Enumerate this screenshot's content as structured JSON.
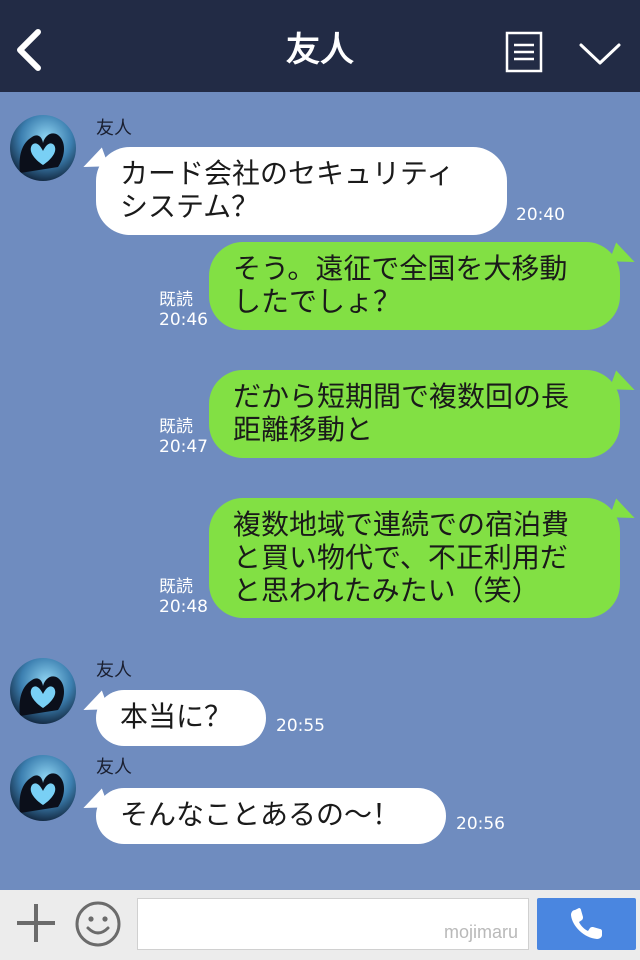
{
  "header": {
    "title": "友人"
  },
  "messages": [
    {
      "direction": "in",
      "sender": "友人",
      "lines": [
        "カード会社のセキュリティ",
        "システム？"
      ],
      "time": "20:40"
    },
    {
      "direction": "out",
      "read": "既読",
      "lines": [
        "そう。遠征で全国を大移動",
        "したでしょ？"
      ],
      "time": "20:46"
    },
    {
      "direction": "out",
      "read": "既読",
      "lines": [
        "だから短期間で複数回の長",
        "距離移動と"
      ],
      "time": "20:47"
    },
    {
      "direction": "out",
      "read": "既読",
      "lines": [
        "複数地域で連続での宿泊費",
        "と買い物代で、不正利用だ",
        "と思われたみたい（笑）"
      ],
      "time": "20:48"
    },
    {
      "direction": "in",
      "sender": "友人",
      "lines": [
        "本当に？"
      ],
      "time": "20:55"
    },
    {
      "direction": "in",
      "sender": "友人",
      "lines": [
        "そんなことあるの〜！"
      ],
      "time": "20:56"
    }
  ],
  "footer": {
    "input_value": "",
    "watermark": "mojimaru"
  },
  "colors": {
    "header_bg": "#222b45",
    "chat_bg": "#6f8cbf",
    "incoming_bubble": "#ffffff",
    "outgoing_bubble": "#82e044",
    "call_button": "#4a86e0"
  },
  "icons": {
    "back": "chevron-left-icon",
    "memo": "notes-icon",
    "menu": "chevron-down-icon",
    "plus": "plus-icon",
    "emoji": "smiley-icon",
    "call": "phone-icon",
    "avatar": "heart-hands-concert-icon"
  }
}
